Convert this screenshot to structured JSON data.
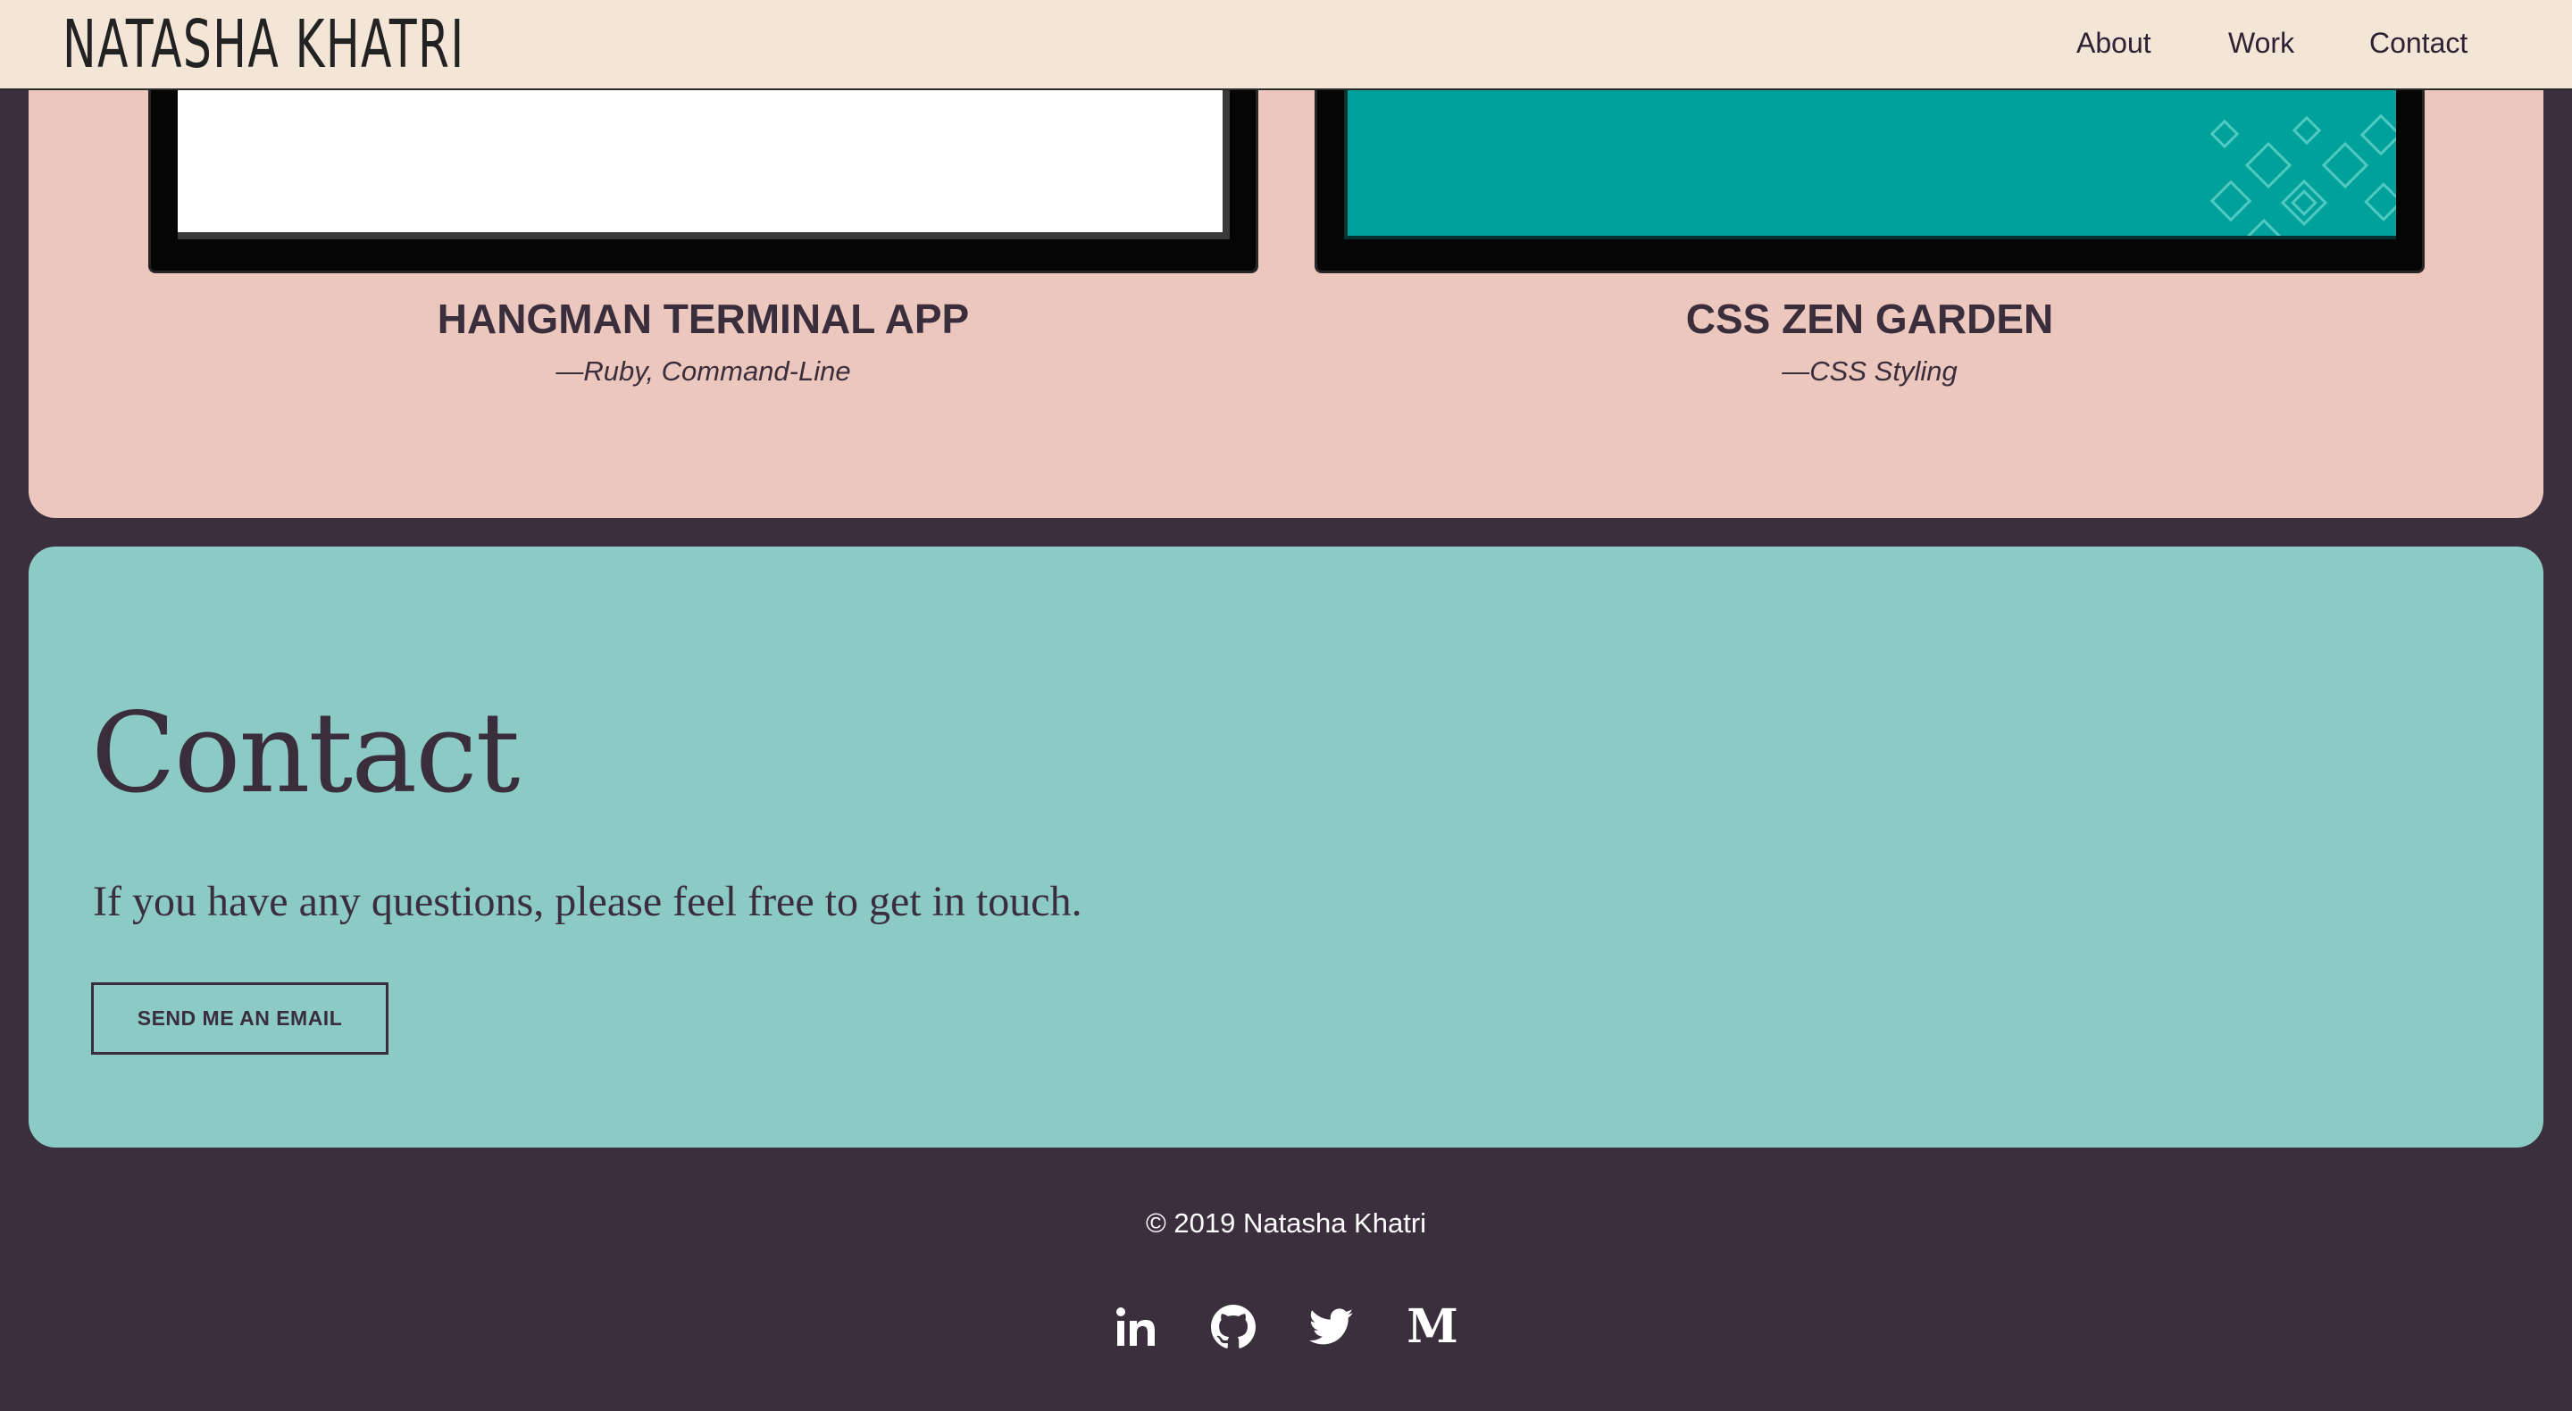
{
  "header": {
    "brand": "NATASHA KHATRI",
    "nav": [
      "About",
      "Work",
      "Contact"
    ]
  },
  "work": {
    "projects": [
      {
        "title": "HANGMAN TERMINAL APP",
        "tech": "—Ruby, Command-Line"
      },
      {
        "title": "CSS ZEN GARDEN",
        "tech": "—CSS Styling"
      }
    ]
  },
  "contact": {
    "heading": "Contact",
    "text": "If you have any questions, please feel free to get in touch.",
    "button": "SEND ME AN EMAIL"
  },
  "footer": {
    "copyright": "© 2019 Natasha Khatri",
    "social": [
      {
        "name": "linkedin-icon",
        "glyph": "in"
      },
      {
        "name": "github-icon"
      },
      {
        "name": "twitter-icon"
      },
      {
        "name": "medium-icon",
        "glyph": "M"
      }
    ]
  },
  "colors": {
    "header_bg": "#f4e6d7",
    "page_bg": "#3b2e3d",
    "work_bg": "#ebc7be",
    "contact_bg": "#8ccac6",
    "text_dark": "#3a2e3c",
    "zen_teal": "#00a19b"
  }
}
